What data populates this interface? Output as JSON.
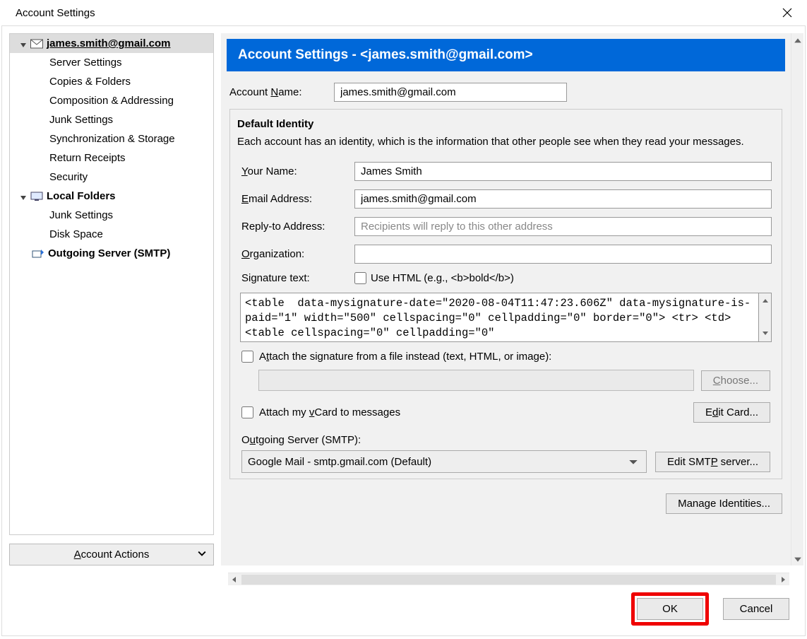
{
  "window": {
    "title": "Account Settings"
  },
  "sidebar": {
    "account": "james.smith@gmail.com",
    "items": [
      "Server Settings",
      "Copies & Folders",
      "Composition & Addressing",
      "Junk Settings",
      "Synchronization & Storage",
      "Return Receipts",
      "Security"
    ],
    "local_folders": "Local Folders",
    "local_items": [
      "Junk Settings",
      "Disk Space"
    ],
    "smtp": "Outgoing Server (SMTP)",
    "account_actions": "Account Actions"
  },
  "banner": "Account Settings - <james.smith@gmail.com>",
  "account_name": {
    "label": "Account Name:",
    "value": "james.smith@gmail.com"
  },
  "identity": {
    "title": "Default Identity",
    "desc": "Each account has an identity, which is the information that other people see when they read your messages.",
    "your_name_label": "Your Name:",
    "your_name_value": "James Smith",
    "email_label": "Email Address:",
    "email_value": "james.smith@gmail.com",
    "replyto_label": "Reply-to Address:",
    "replyto_placeholder": "Recipients will reply to this other address",
    "org_label": "Organization:",
    "org_value": "",
    "sig_label": "Signature text:",
    "use_html_label": "Use HTML (e.g., <b>bold</b>)",
    "signature_value": "<table  data-mysignature-date=\"2020-08-04T11:47:23.606Z\" data-mysignature-is-paid=\"1\" width=\"500\" cellspacing=\"0\" cellpadding=\"0\" border=\"0\"> <tr> <td> <table cellspacing=\"0\" cellpadding=\"0\"",
    "attach_file_label": "Attach the signature from a file instead (text, HTML, or image):",
    "choose_label": "Choose...",
    "vcard_label": "Attach my vCard to messages",
    "edit_card_label": "Edit Card...",
    "smtp_header": "Outgoing Server (SMTP):",
    "smtp_selected": "Google Mail - smtp.gmail.com (Default)",
    "edit_smtp_label": "Edit SMTP server...",
    "manage_identities_label": "Manage Identities..."
  },
  "footer": {
    "ok": "OK",
    "cancel": "Cancel"
  }
}
